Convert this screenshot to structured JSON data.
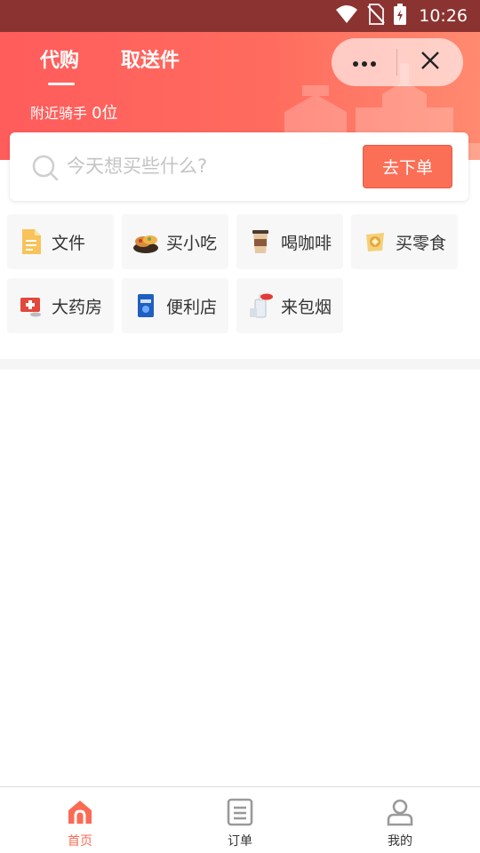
{
  "status_bar": {
    "time": "10:26"
  },
  "header": {
    "tabs": [
      {
        "label": "代购",
        "active": true
      },
      {
        "label": "取送件",
        "active": false
      }
    ],
    "riders_prefix": "附近骑手",
    "riders_count": "0位"
  },
  "search": {
    "placeholder": "今天想买些什么?",
    "value": "",
    "button_label": "去下单"
  },
  "categories": [
    {
      "label": "文件",
      "icon": "document-icon"
    },
    {
      "label": "买小吃",
      "icon": "snack-icon"
    },
    {
      "label": "喝咖啡",
      "icon": "coffee-icon"
    },
    {
      "label": "买零食",
      "icon": "chips-icon"
    },
    {
      "label": "大药房",
      "icon": "medicine-icon"
    },
    {
      "label": "便利店",
      "icon": "store-icon"
    },
    {
      "label": "来包烟",
      "icon": "cigarette-icon"
    }
  ],
  "bottom_nav": [
    {
      "label": "首页",
      "icon": "home-icon",
      "active": true
    },
    {
      "label": "订单",
      "icon": "orders-icon",
      "active": false
    },
    {
      "label": "我的",
      "icon": "profile-icon",
      "active": false
    }
  ],
  "colors": {
    "accent": "#fb6f57",
    "header_start": "#ff5c5c",
    "status_bar": "#8b3330",
    "active_nav": "#fa6b54"
  }
}
